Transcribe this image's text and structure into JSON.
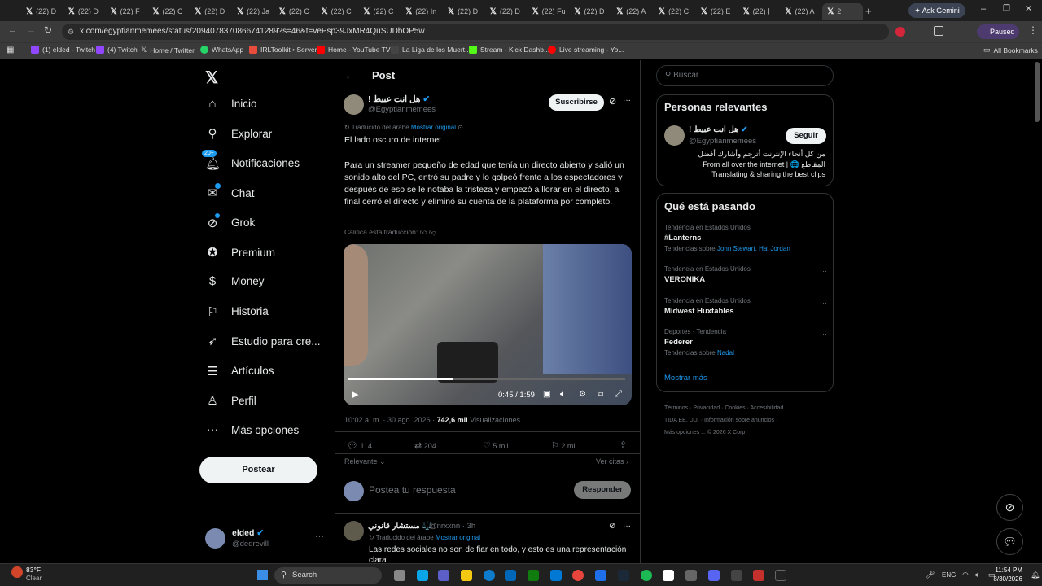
{
  "browser": {
    "tabs": [
      "(22) D",
      "(22) D",
      "(22) F",
      "(22) C",
      "(22) D",
      "(22) Ja",
      "(22) C",
      "(22) C",
      "(22) C",
      "(22) In",
      "(22) D",
      "(22) D",
      "(22) Fu",
      "(22) D",
      "(22) A",
      "(22) C",
      "(22) E",
      "(22) إ",
      "(22) A",
      "2"
    ],
    "ask_gemini": "Ask Gemini",
    "url": "x.com/egyptianmemees/status/2094078370866741289?s=46&t=vePsp39JxMR4QuSUDbOP5w",
    "paused": "Paused",
    "bookmarks": [
      "(1) elded - Twitch",
      "(4) Twitch",
      "Home / Twitter",
      "WhatsApp",
      "IRLToolkit • Server",
      "Home - YouTube TV",
      "La Liga de los Muert...",
      "Stream - Kick Dashb...",
      "Live streaming - Yo..."
    ],
    "all_bookmarks": "All Bookmarks"
  },
  "sidebar": {
    "items": [
      {
        "label": "Inicio",
        "icon": "home-icon"
      },
      {
        "label": "Explorar",
        "icon": "search-icon"
      },
      {
        "label": "Notificaciones",
        "icon": "bell-icon",
        "badge": "20+"
      },
      {
        "label": "Chat",
        "icon": "chat-icon"
      },
      {
        "label": "Grok",
        "icon": "grok-icon"
      },
      {
        "label": "Premium",
        "icon": "premium-icon"
      },
      {
        "label": "Money",
        "icon": "money-icon"
      },
      {
        "label": "Historia",
        "icon": "bookmark-icon"
      },
      {
        "label": "Estudio para cre...",
        "icon": "rocket-icon"
      },
      {
        "label": "Artículos",
        "icon": "articles-icon"
      },
      {
        "label": "Perfil",
        "icon": "person-icon"
      },
      {
        "label": "Más opciones",
        "icon": "more-circle-icon"
      }
    ],
    "post_button": "Postear",
    "account_name": "elded",
    "account_handle": "@dedrevill"
  },
  "main": {
    "header_title": "Post",
    "author_name": "هل انت عبيط !",
    "author_handle": "@Egyptianmemees",
    "subscribe": "Suscribirse",
    "translated_from": "Traducido del árabe",
    "show_original": "Mostrar original",
    "text_title": "El lado oscuro de internet",
    "text_body": "Para un streamer pequeño de edad que tenía un directo abierto y salió un sonido alto del PC, entró su padre y lo golpeó frente a los espectadores y después de eso se le notaba la tristeza y empezó a llorar en el directo, al final cerró el directo y eliminó su cuenta de la plataforma por completo.",
    "rate_translation": "Califica esta traducción:",
    "video_time": "0:45 / 1:59",
    "video_progress": 0.377,
    "timestamp": "10:02 a. m. · 30 ago. 2026 ·",
    "views_count": "742,6 mil",
    "views_label": "Visualizaciones",
    "replies": "114",
    "reposts": "204",
    "likes": "5 mil",
    "bookmarks": "2 mil",
    "sort_label": "Relevante",
    "quotes_label": "Ver citas",
    "reply_placeholder": "Postea tu respuesta",
    "reply_button": "Responder",
    "reply_author": "مستشار قانوني ⚖️",
    "reply_handle": "@nrxxnn · 3h",
    "reply_translated": "Traducido del árabe",
    "reply_show_original": "Mostrar original",
    "reply_text": "Las redes sociales no son de fiar en todo, y esto es una representación clara"
  },
  "right": {
    "search_placeholder": "Buscar",
    "relevant_title": "Personas relevantes",
    "person_name": "هل انت عبيط !",
    "person_handle": "@Egyptianmemees",
    "follow": "Seguir",
    "bio_line1": "من كل أنحاء الإنترنت أترجم وأشارك أفضل",
    "bio_line2": "From all over the internet | 🌐 المقاطع",
    "bio_line3": "Translating & sharing the best clips",
    "trends_title": "Qué está pasando",
    "trends": [
      {
        "category": "Tendencia en Estados Unidos",
        "name": "#Lanterns",
        "extra_prefix": "Tendencias sobre",
        "extra_links": "John Stewart, Hal Jordan"
      },
      {
        "category": "Tendencia en Estados Unidos",
        "name": "VERONIKA",
        "extra_prefix": "",
        "extra_links": ""
      },
      {
        "category": "Tendencia en Estados Unidos",
        "name": "Midwest Huxtables",
        "extra_prefix": "",
        "extra_links": ""
      },
      {
        "category": "Deportes · Tendencia",
        "name": "Federer",
        "extra_prefix": "Tendencias sobre",
        "extra_links": "Nadal"
      }
    ],
    "show_more": "Mostrar más",
    "footer": [
      "Términos",
      "Privacidad",
      "Cookies",
      "Accesibilidad",
      "TIDA EE. UU.",
      "Información sobre anuncios",
      "Más opciones ...",
      "© 2026 X Corp."
    ]
  },
  "taskbar": {
    "weather_temp": "83°F",
    "weather_desc": "Clear",
    "search": "Search",
    "lang": "ENG",
    "time": "11:54 PM",
    "date": "8/30/2026"
  }
}
